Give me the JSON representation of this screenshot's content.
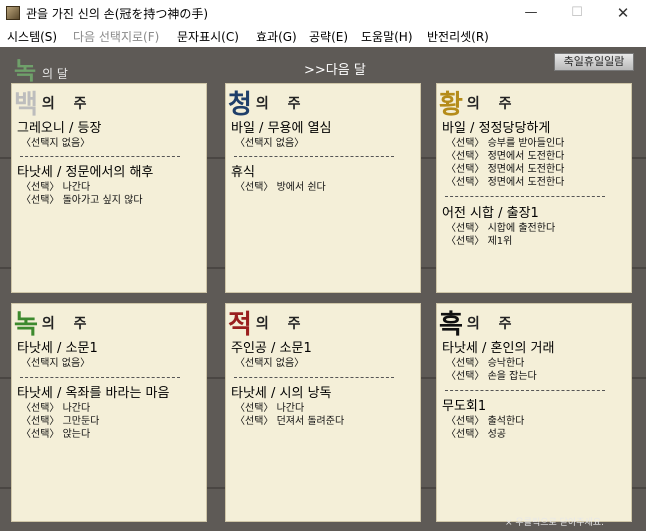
{
  "window": {
    "title": "관을 가진 신의 손(冠を持つ神の手)",
    "min_symbol": "—",
    "max_symbol": "☐",
    "close_symbol": "✕"
  },
  "menu": [
    {
      "label": "시스템(S)",
      "enabled": true
    },
    {
      "label": "다음 선택지로(F)",
      "enabled": false
    },
    {
      "label": "문자표시(C)",
      "enabled": true
    },
    {
      "label": "효과(G)",
      "enabled": true
    },
    {
      "label": "공략(E)",
      "enabled": true
    },
    {
      "label": "도움말(H)",
      "enabled": true
    },
    {
      "label": "반전리셋(R)",
      "enabled": true
    }
  ],
  "header": {
    "month_char": "녹",
    "month_suffix": "의 달",
    "next_month": ">>다음 달",
    "holiday_button": "축일휴일일람"
  },
  "colors": {
    "white": "#bdbdbd",
    "blue": "#1f3f6a",
    "yellow": "#b58c1a",
    "green": "#3d8a2e",
    "red": "#9a1f1f",
    "black": "#111111",
    "panel_bg": "#f4efd8",
    "background": "#5e5a56"
  },
  "weeks": [
    {
      "char": "백",
      "char_color": "#bdbdbd",
      "label": "의 주",
      "sections": [
        {
          "title": "그레오니 / 등장",
          "choices": [
            "〈선택지 없음〉"
          ]
        },
        {
          "title": "타낫세 / 정문에서의 해후",
          "choices": [
            "〈선택〉 나간다",
            "〈선택〉 돌아가고 싶지 않다"
          ]
        }
      ]
    },
    {
      "char": "청",
      "char_color": "#1f3f6a",
      "label": "의 주",
      "sections": [
        {
          "title": "바일 / 무용에 열심",
          "choices": [
            "〈선택지 없음〉"
          ]
        },
        {
          "title": "휴식",
          "choices": [
            "〈선택〉 방에서 쉰다"
          ]
        }
      ]
    },
    {
      "char": "황",
      "char_color": "#b58c1a",
      "label": "의 주",
      "sections": [
        {
          "title": "바일 / 정정당당하게",
          "choices": [
            "〈선택〉 승부를 받아들인다",
            "〈선택〉 정면에서 도전한다",
            "〈선택〉 정면에서 도전한다",
            "〈선택〉 정면에서 도전한다"
          ]
        },
        {
          "title": "어전 시합 / 출장1",
          "choices": [
            "〈선택〉 시합에 출전한다",
            "〈선택〉 제1위"
          ]
        }
      ]
    },
    {
      "char": "녹",
      "char_color": "#3d8a2e",
      "label": "의 주",
      "sections": [
        {
          "title": "타낫세 / 소문1",
          "choices": [
            "〈선택지 없음〉"
          ]
        },
        {
          "title": "타낫세 / 옥좌를 바라는 마음",
          "choices": [
            "〈선택〉 나간다",
            "〈선택〉 그만둔다",
            "〈선택〉 앉는다"
          ]
        }
      ]
    },
    {
      "char": "적",
      "char_color": "#9a1f1f",
      "label": "의 주",
      "sections": [
        {
          "title": "주인공 / 소문1",
          "choices": [
            "〈선택지 없음〉"
          ]
        },
        {
          "title": "타낫세 / 시의 낭독",
          "choices": [
            "〈선택〉 나간다",
            "〈선택〉 던져서 돌려준다"
          ]
        }
      ]
    },
    {
      "char": "흑",
      "char_color": "#111111",
      "label": "의 주",
      "sections": [
        {
          "title": "타낫세 / 혼인의 거래",
          "choices": [
            "〈선택〉 승낙한다",
            "〈선택〉 손을 잡는다"
          ]
        },
        {
          "title": "무도회1",
          "choices": [
            "〈선택〉 출석한다",
            "〈선택〉 성공"
          ]
        }
      ]
    }
  ],
  "footer": {
    "note": "× 우클릭으로 닫아주세요."
  }
}
